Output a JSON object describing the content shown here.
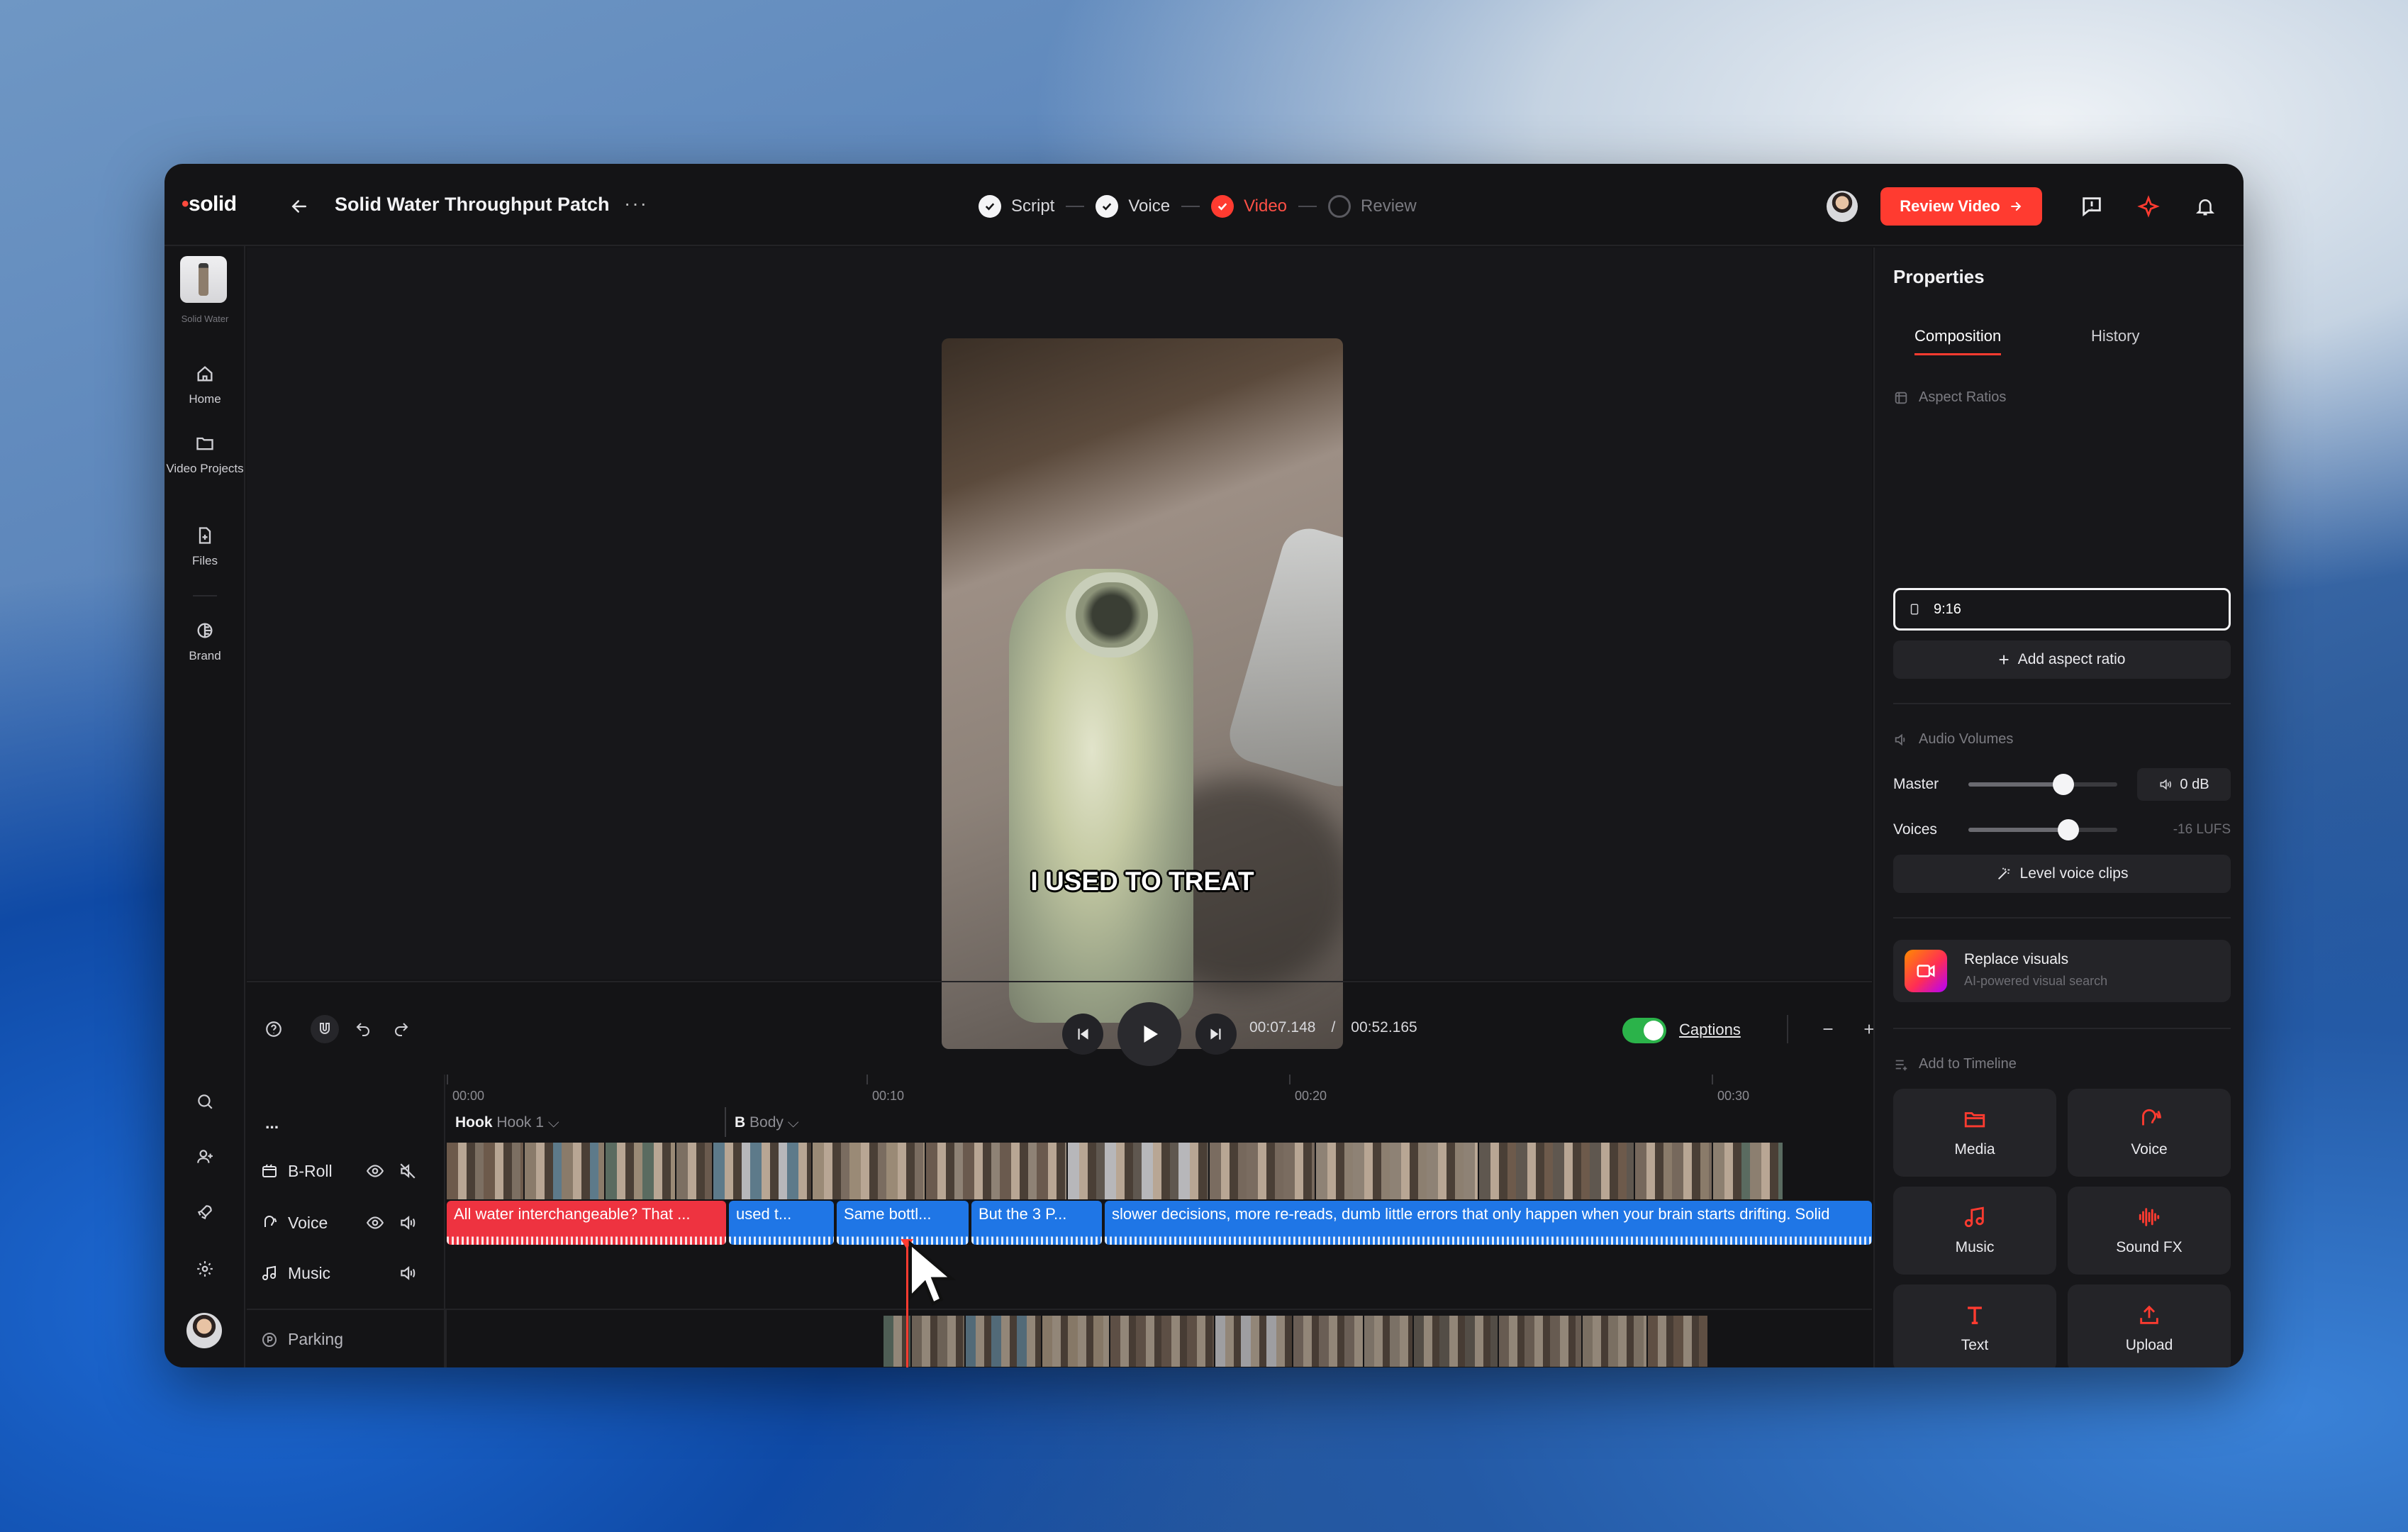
{
  "brand": {
    "logo": "solid",
    "thumb_caption": "Solid Water"
  },
  "header": {
    "project_title": "Solid Water Throughput Patch",
    "more": "···",
    "steps": [
      {
        "label": "Script",
        "state": "done"
      },
      {
        "label": "Voice",
        "state": "done"
      },
      {
        "label": "Video",
        "state": "active"
      },
      {
        "label": "Review",
        "state": "pending"
      }
    ],
    "review_button": "Review Video"
  },
  "sidebar": {
    "items": [
      {
        "label": "Home",
        "icon": "home-icon"
      },
      {
        "label": "Video Projects",
        "icon": "folder-icon"
      },
      {
        "label": "Files",
        "icon": "file-icon"
      },
      {
        "label": "Brand",
        "icon": "brand-icon"
      }
    ],
    "bottom_icons": [
      "search-icon",
      "user-add-icon",
      "rocket-icon",
      "gear-icon",
      "avatar"
    ]
  },
  "preview": {
    "caption": "I USED TO TREAT"
  },
  "controls": {
    "current_time": "00:07.148",
    "separator": "/",
    "total_time": "00:52.165",
    "captions_label": "Captions",
    "captions_on": true
  },
  "timeline": {
    "more": "...",
    "ruler": [
      "00:00",
      "00:10",
      "00:20",
      "00:30"
    ],
    "sections": [
      {
        "name": "Hook",
        "sub": "Hook 1"
      },
      {
        "name": "B",
        "sub": "Body"
      }
    ],
    "tracks": [
      {
        "label": "B-Roll"
      },
      {
        "label": "Voice"
      },
      {
        "label": "Music"
      },
      {
        "label": "Parking"
      }
    ],
    "voice_clips": [
      {
        "text": "All water interchangeable? That ...",
        "color": "#ee3340"
      },
      {
        "text": "used t...",
        "color": "#1f76e6"
      },
      {
        "text": "Same bottl...",
        "color": "#1f76e6"
      },
      {
        "text": "But the 3 P...",
        "color": "#1f76e6"
      },
      {
        "text": "slower decisions, more re-reads, dumb little errors that only happen when your brain starts drifting. Solid",
        "color": "#1f76e6"
      }
    ],
    "playhead_progress": 0.137
  },
  "properties": {
    "title": "Properties",
    "tabs": [
      "Composition",
      "History"
    ],
    "aspect_section": "Aspect Ratios",
    "aspect_value": "9:16",
    "add_aspect": "Add aspect ratio",
    "audio_section": "Audio Volumes",
    "master_label": "Master",
    "master_db": "0 dB",
    "master_level": 0.64,
    "voices_label": "Voices",
    "voices_lufs": "-16 LUFS",
    "voices_level": 0.67,
    "level_button": "Level voice clips",
    "replace_title": "Replace visuals",
    "replace_sub": "AI-powered visual search",
    "add_section": "Add to Timeline",
    "add_items": [
      {
        "label": "Media",
        "icon": "folder-icon"
      },
      {
        "label": "Voice",
        "icon": "voice-icon"
      },
      {
        "label": "Music",
        "icon": "music-icon"
      },
      {
        "label": "Sound FX",
        "icon": "waveform-icon"
      },
      {
        "label": "Text",
        "icon": "text-icon"
      },
      {
        "label": "Upload",
        "icon": "upload-icon"
      }
    ]
  },
  "colors": {
    "accent": "#ff3b30",
    "voice_red": "#ee3340",
    "voice_blue": "#1f76e6",
    "toggle_on": "#2bb34a"
  }
}
